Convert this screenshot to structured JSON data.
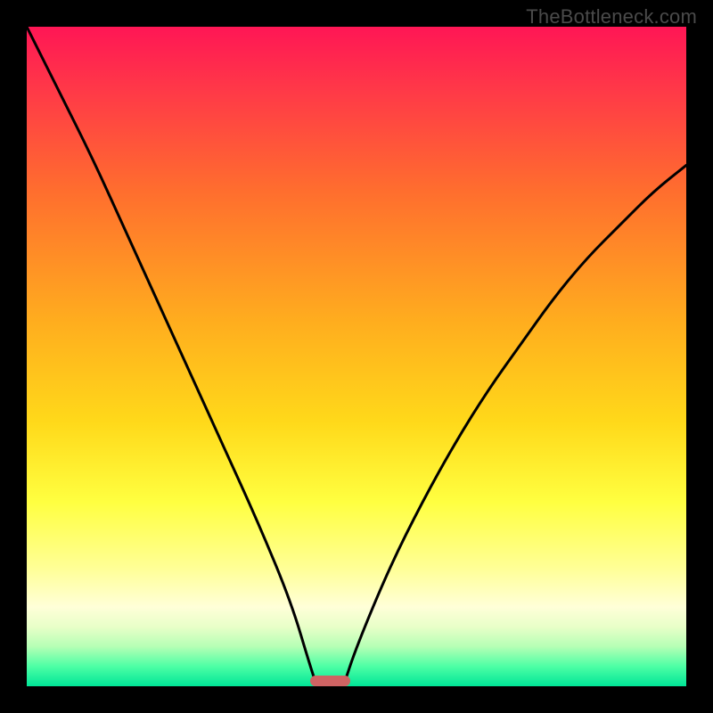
{
  "watermark": "TheBottleneck.com",
  "chart_data": {
    "type": "line",
    "title": "",
    "xlabel": "",
    "ylabel": "",
    "xlim": [
      0,
      100
    ],
    "ylim": [
      0,
      100
    ],
    "grid": false,
    "legend": false,
    "series": [
      {
        "name": "left-curve",
        "x": [
          0,
          5,
          10,
          15,
          20,
          25,
          30,
          35,
          40,
          43,
          44
        ],
        "y": [
          100,
          90,
          80,
          69,
          58,
          47,
          36,
          25,
          13,
          3,
          0
        ]
      },
      {
        "name": "right-curve",
        "x": [
          48,
          50,
          55,
          60,
          65,
          70,
          75,
          80,
          85,
          90,
          95,
          100
        ],
        "y": [
          0,
          6,
          18,
          28,
          37,
          45,
          52,
          59,
          65,
          70,
          75,
          79
        ]
      }
    ],
    "marker": {
      "x_start": 43,
      "x_end": 49,
      "color": "#cf6363"
    },
    "background_gradient": {
      "top": "#ff1655",
      "mid": "#ffd91a",
      "bottom": "#00e597"
    }
  }
}
